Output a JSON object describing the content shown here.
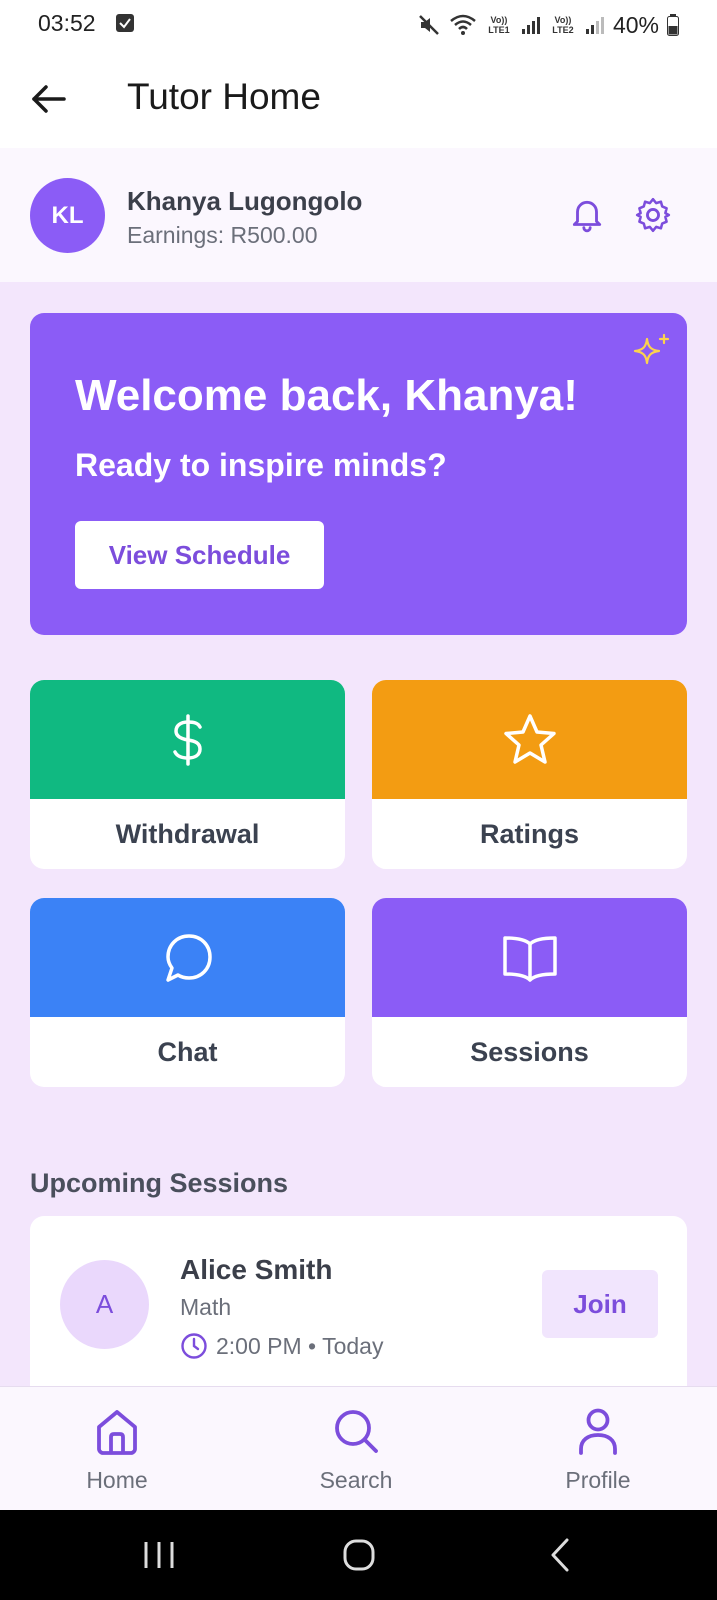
{
  "status_bar": {
    "time": "03:52",
    "battery": "40%",
    "sim1": "Vo)) LTE1",
    "sim2": "Vo)) LTE2"
  },
  "app_bar": {
    "title": "Tutor Home"
  },
  "profile": {
    "initials": "KL",
    "name": "Khanya Lugongolo",
    "earnings": "Earnings: R500.00"
  },
  "welcome": {
    "title": "Welcome back, Khanya!",
    "subtitle": "Ready to inspire minds?",
    "button_label": "View Schedule"
  },
  "tiles": [
    {
      "label": "Withdrawal",
      "color": "#10b981",
      "icon": "dollar-icon"
    },
    {
      "label": "Ratings",
      "color": "#f39c12",
      "icon": "star-icon"
    },
    {
      "label": "Chat",
      "color": "#3b82f6",
      "icon": "chat-bubble-icon"
    },
    {
      "label": "Sessions",
      "color": "#8b5cf6",
      "icon": "book-open-icon"
    }
  ],
  "upcoming": {
    "title": "Upcoming Sessions",
    "sessions": [
      {
        "initial": "A",
        "name": "Alice Smith",
        "subject": "Math",
        "time": "2:00 PM • Today",
        "button_label": "Join"
      }
    ]
  },
  "bottom_nav": [
    {
      "label": "Home",
      "icon": "home-icon"
    },
    {
      "label": "Search",
      "icon": "search-icon"
    },
    {
      "label": "Profile",
      "icon": "user-icon"
    }
  ],
  "colors": {
    "accent": "#8b5cf6",
    "accent_text": "#7c4ddc",
    "page_bg": "#f3e6fc"
  }
}
